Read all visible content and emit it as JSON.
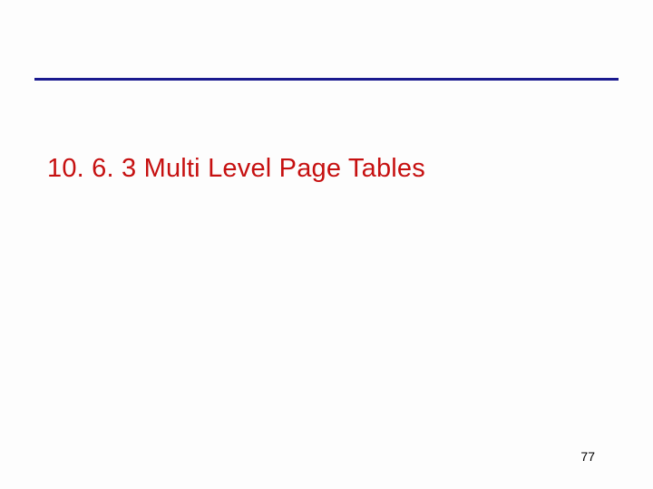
{
  "heading": "10. 6. 3  Multi Level Page Tables",
  "page_number": "77"
}
